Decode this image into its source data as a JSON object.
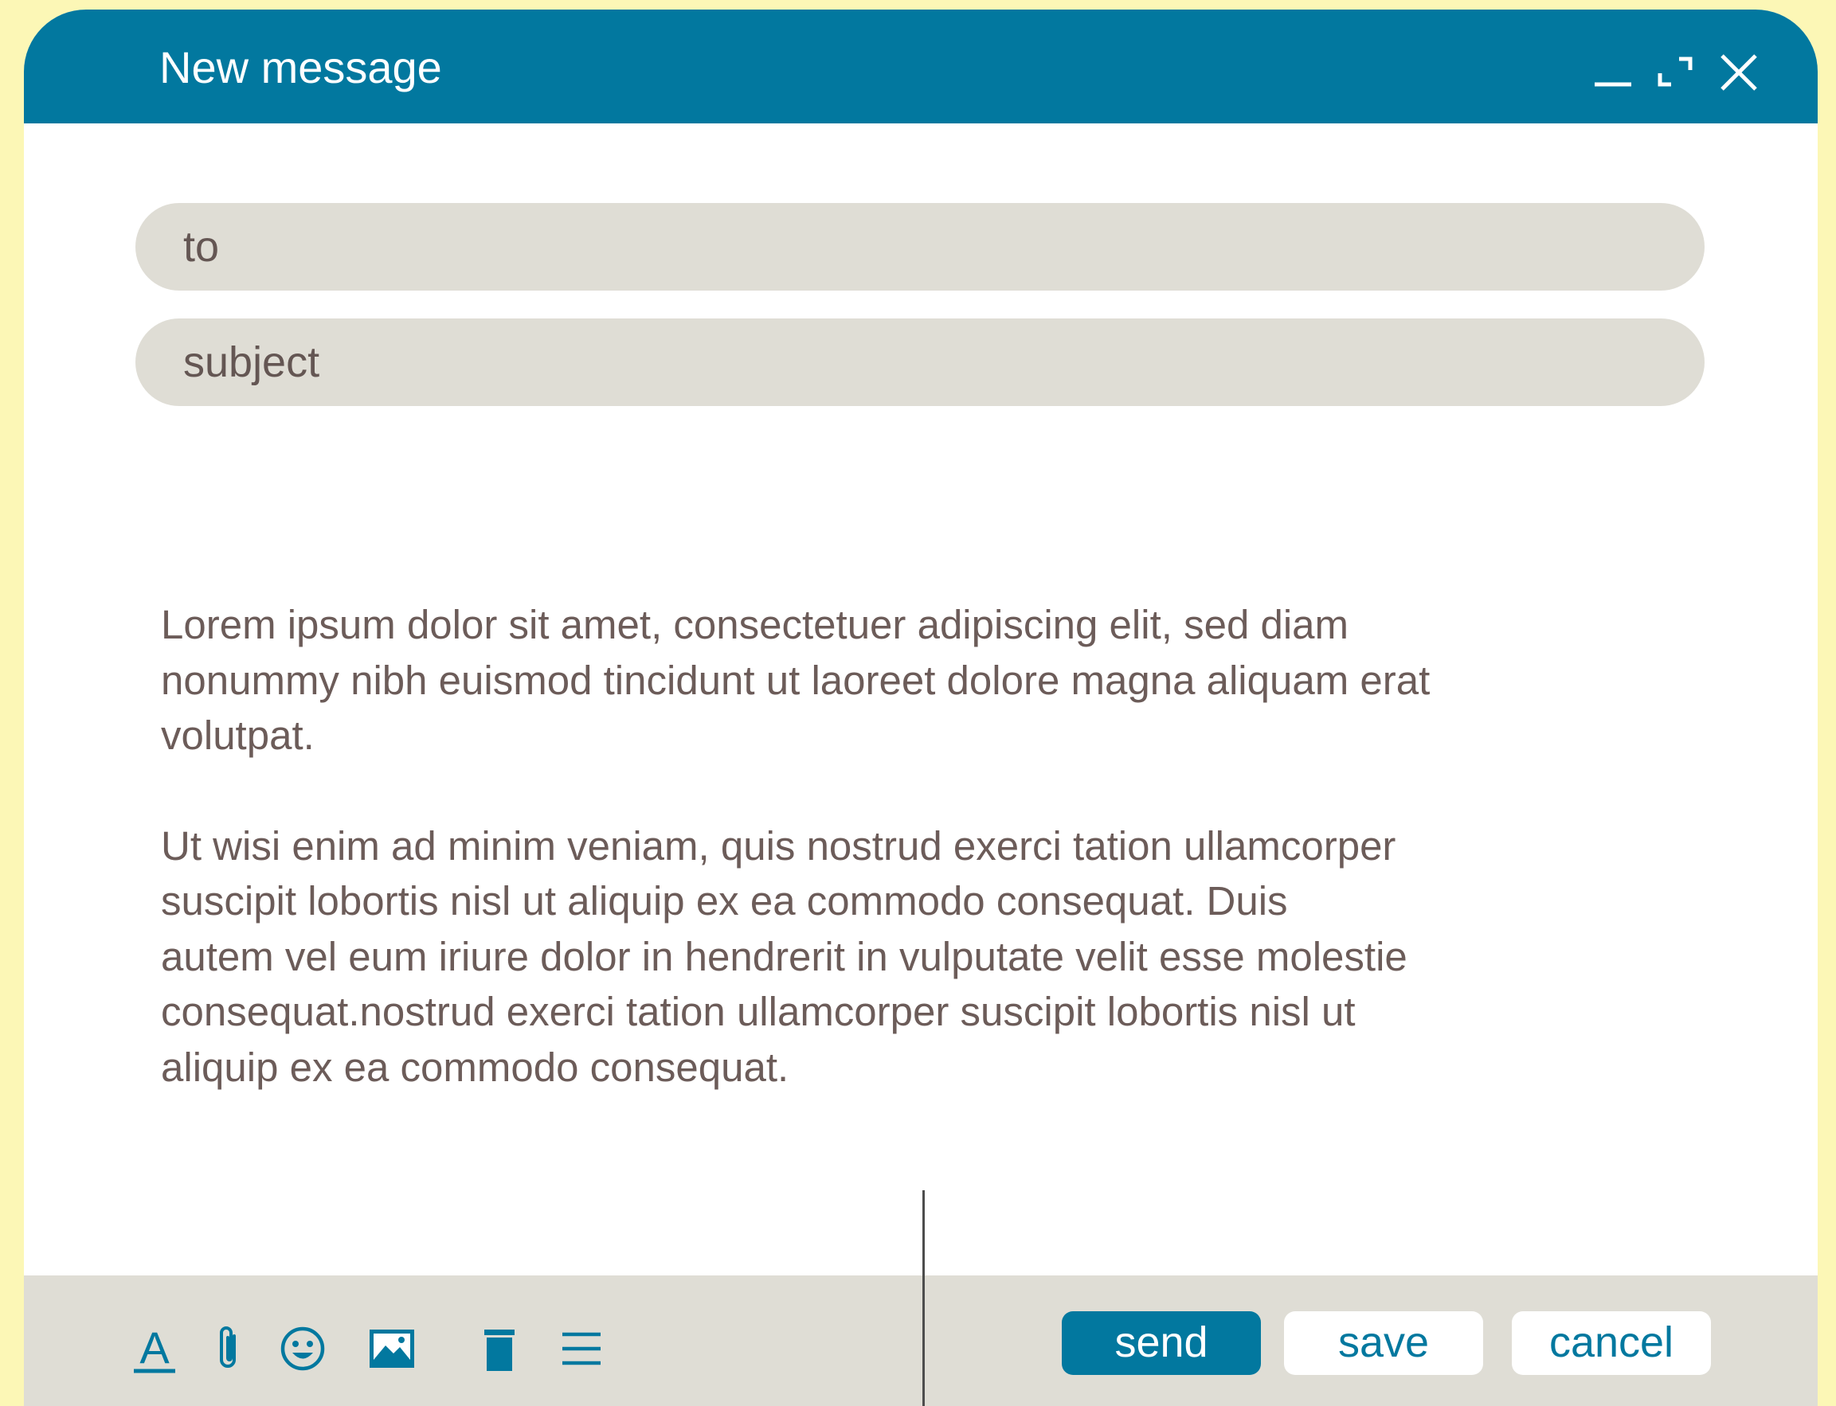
{
  "window": {
    "title": "New message",
    "controls": [
      "minimize-icon",
      "maximize-icon",
      "close-icon"
    ]
  },
  "fields": {
    "to_placeholder": "to",
    "subject_placeholder": "subject"
  },
  "body": {
    "paragraph_1": "Lorem ipsum dolor sit amet, consectetuer adipiscing elit, sed diam\nnonummy nibh euismod tincidunt ut laoreet dolore magna aliquam erat\nvolutpat.",
    "paragraph_2": "Ut wisi enim ad minim veniam, quis nostrud exerci tation ullamcorper\nsuscipit lobortis nisl ut aliquip ex ea commodo consequat. Duis\nautem vel eum iriure dolor in hendrerit in vulputate velit esse molestie\nconsequat.nostrud exerci tation ullamcorper suscipit lobortis nisl ut\naliquip ex ea commodo consequat."
  },
  "toolbar": {
    "tools": [
      "text-format-icon",
      "attachment-icon",
      "emoji-icon",
      "image-icon",
      "trash-icon",
      "menu-icon"
    ],
    "send_label": "send",
    "save_label": "save",
    "cancel_label": "cancel"
  },
  "colors": {
    "accent": "#02789f",
    "background": "#fcf7b6",
    "field": "#dfddd5",
    "text": "#6c5c59"
  }
}
